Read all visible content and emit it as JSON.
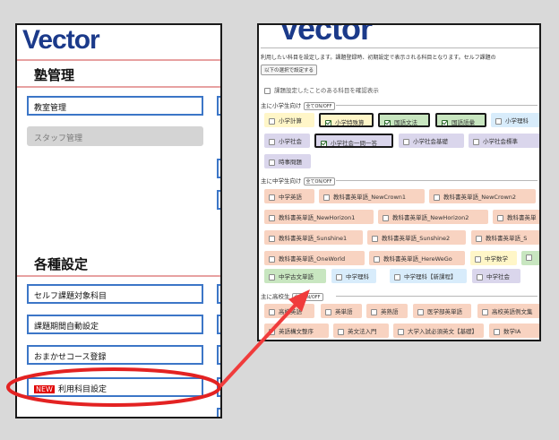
{
  "left": {
    "logo": "Vector",
    "section1": "塾管理",
    "items1": [
      "教室管理",
      "スタッフ管理"
    ],
    "section2": "各種設定",
    "items2": [
      "セルフ課題対象科目",
      "課題期間自動設定",
      "おまかせコース登録"
    ],
    "new_badge": "NEW",
    "new_item": "利用科目設定"
  },
  "right": {
    "logo": "Vector",
    "intro": "利用したい科目を設定します。課題登録時、初期設定で表示される科目となります。セルフ課題の",
    "set_button": "以下の選択で設定する",
    "history_label": "課題設定したことのある科目を確認表示",
    "onoff": "全てON/OFF",
    "elementary": {
      "title": "主に小学生向け",
      "chips": [
        "小学計算",
        "小学特殊算",
        "国語文法",
        "国語語彙",
        "小学理科",
        "小学社会",
        "小学社会一問一答",
        "小学社会基礎",
        "小学社会標準",
        "時事問題"
      ]
    },
    "middle": {
      "title": "主に中学生向け",
      "chips": [
        "中学英語",
        "教科書英単語_NewCrown1",
        "教科書英単語_NewCrown2",
        "教科書英単語_NewHorizon1",
        "教科書英単語_NewHorizon2",
        "教科書英単",
        "教科書英単語_Sunshine1",
        "教科書英単語_Sunshine2",
        "教科書英単語_S",
        "教科書英単語_OneWorld",
        "教科書英単語_HereWeGo",
        "中学数学",
        "中学古文単語",
        "中学理科",
        "中学理科【新課程】",
        "中学社会"
      ]
    },
    "high": {
      "title": "主に高校生",
      "chips": [
        "高校英語",
        "英単語",
        "英熟語",
        "医学部英単語",
        "高校英語例文集",
        "英語構文整序",
        "英文法入門",
        "大学入試必須英文【基礎】",
        "数学IA"
      ]
    }
  }
}
